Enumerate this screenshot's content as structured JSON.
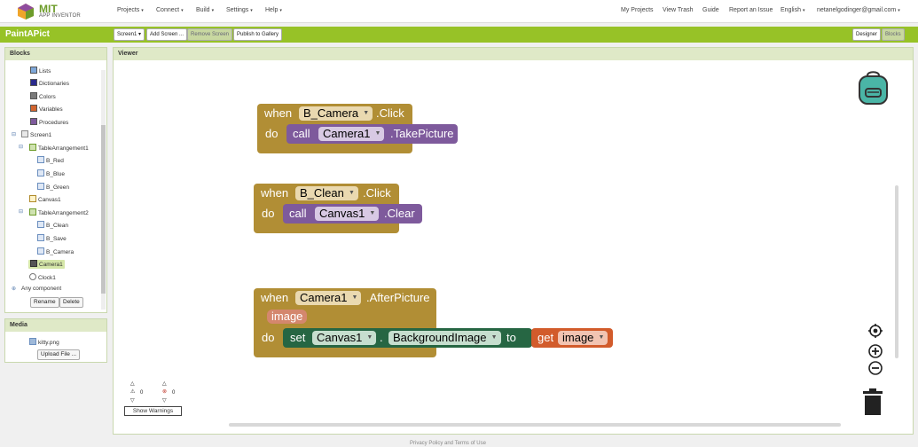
{
  "nav": {
    "brand_line1": "MIT",
    "brand_line2": "APP INVENTOR",
    "menus": [
      "Projects",
      "Connect",
      "Build",
      "Settings",
      "Help"
    ],
    "right": [
      "My Projects",
      "View Trash",
      "Guide",
      "Report an Issue",
      "English",
      "netanelgodinger@gmail.com"
    ]
  },
  "toolbar": {
    "project_name": "PaintAPict",
    "screen_select": "Screen1",
    "add_screen": "Add Screen ...",
    "remove_screen": "Remove Screen",
    "publish": "Publish to Gallery",
    "designer": "Designer",
    "blocks": "Blocks"
  },
  "blocks_panel": {
    "title": "Blocks",
    "builtin": [
      {
        "label": "Lists",
        "color": "#7ea7d8"
      },
      {
        "label": "Dictionaries",
        "color": "#2a2a8c"
      },
      {
        "label": "Colors",
        "color": "#7a7a7a"
      },
      {
        "label": "Variables",
        "color": "#d2642e"
      },
      {
        "label": "Procedures",
        "color": "#7e5a9c"
      }
    ],
    "screen": "Screen1",
    "tree": [
      "TableArrangement1",
      "B_Red",
      "B_Blue",
      "B_Green",
      "Canvas1",
      "TableArrangement2",
      "B_Clean",
      "B_Save",
      "B_Camera",
      "Camera1",
      "Clock1"
    ],
    "any_component": "Any component",
    "rename": "Rename",
    "delete": "Delete"
  },
  "media_panel": {
    "title": "Media",
    "file": "kitty.png",
    "upload": "Upload File ..."
  },
  "viewer": {
    "title": "Viewer"
  },
  "workspace": {
    "block1": {
      "when": "when",
      "component": "B_Camera",
      "event": ".Click",
      "do": "do",
      "call": "call",
      "target": "Camera1",
      "method": ".TakePicture"
    },
    "block2": {
      "when": "when",
      "component": "B_Clean",
      "event": ".Click",
      "do": "do",
      "call": "call",
      "target": "Canvas1",
      "method": ".Clear"
    },
    "block3": {
      "when": "when",
      "component": "Camera1",
      "event": ".AfterPicture",
      "param": "image",
      "do": "do",
      "set": "set",
      "target": "Canvas1",
      "dot": ".",
      "property": "BackgroundImage",
      "to": "to",
      "get": "get",
      "var": "image"
    },
    "warnings_count": "0",
    "errors_count": "0",
    "show_warnings": "Show Warnings"
  },
  "footer": "Privacy Policy and Terms of Use",
  "colors": {
    "accent": "#97c227",
    "event": "#b18e35",
    "call": "#7e5a9c",
    "setter": "#266643",
    "getter": "#d25b2b"
  }
}
